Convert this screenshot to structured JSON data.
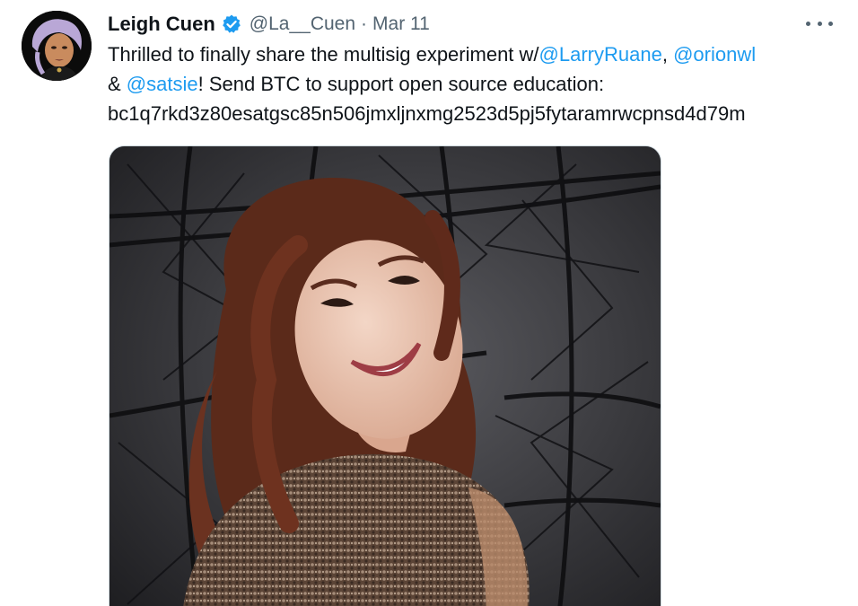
{
  "tweet": {
    "display_name": "Leigh Cuen",
    "handle": "@La__Cuen",
    "separator": "·",
    "date": "Mar 11",
    "verified_icon": "verified-badge-icon",
    "more_icon": "more-options-icon",
    "text": {
      "line1_prefix": "Thrilled to finally share the multisig experiment w/",
      "mention1": "@LarryRuane",
      "line1_sep": ", ",
      "mention2": "@orionwl",
      "line2_prefix": "& ",
      "mention3": "@satsie",
      "line2_suffix": "! Send BTC to support open source education:",
      "line3": "bc1q7rkd3z80esatgsc85n506jmxljnxmg2523d5pj5fytaramrwcpnsd4d79m"
    }
  },
  "colors": {
    "link": "#1d9bf0",
    "secondary_text": "#536471",
    "primary_text": "#0f1419"
  }
}
